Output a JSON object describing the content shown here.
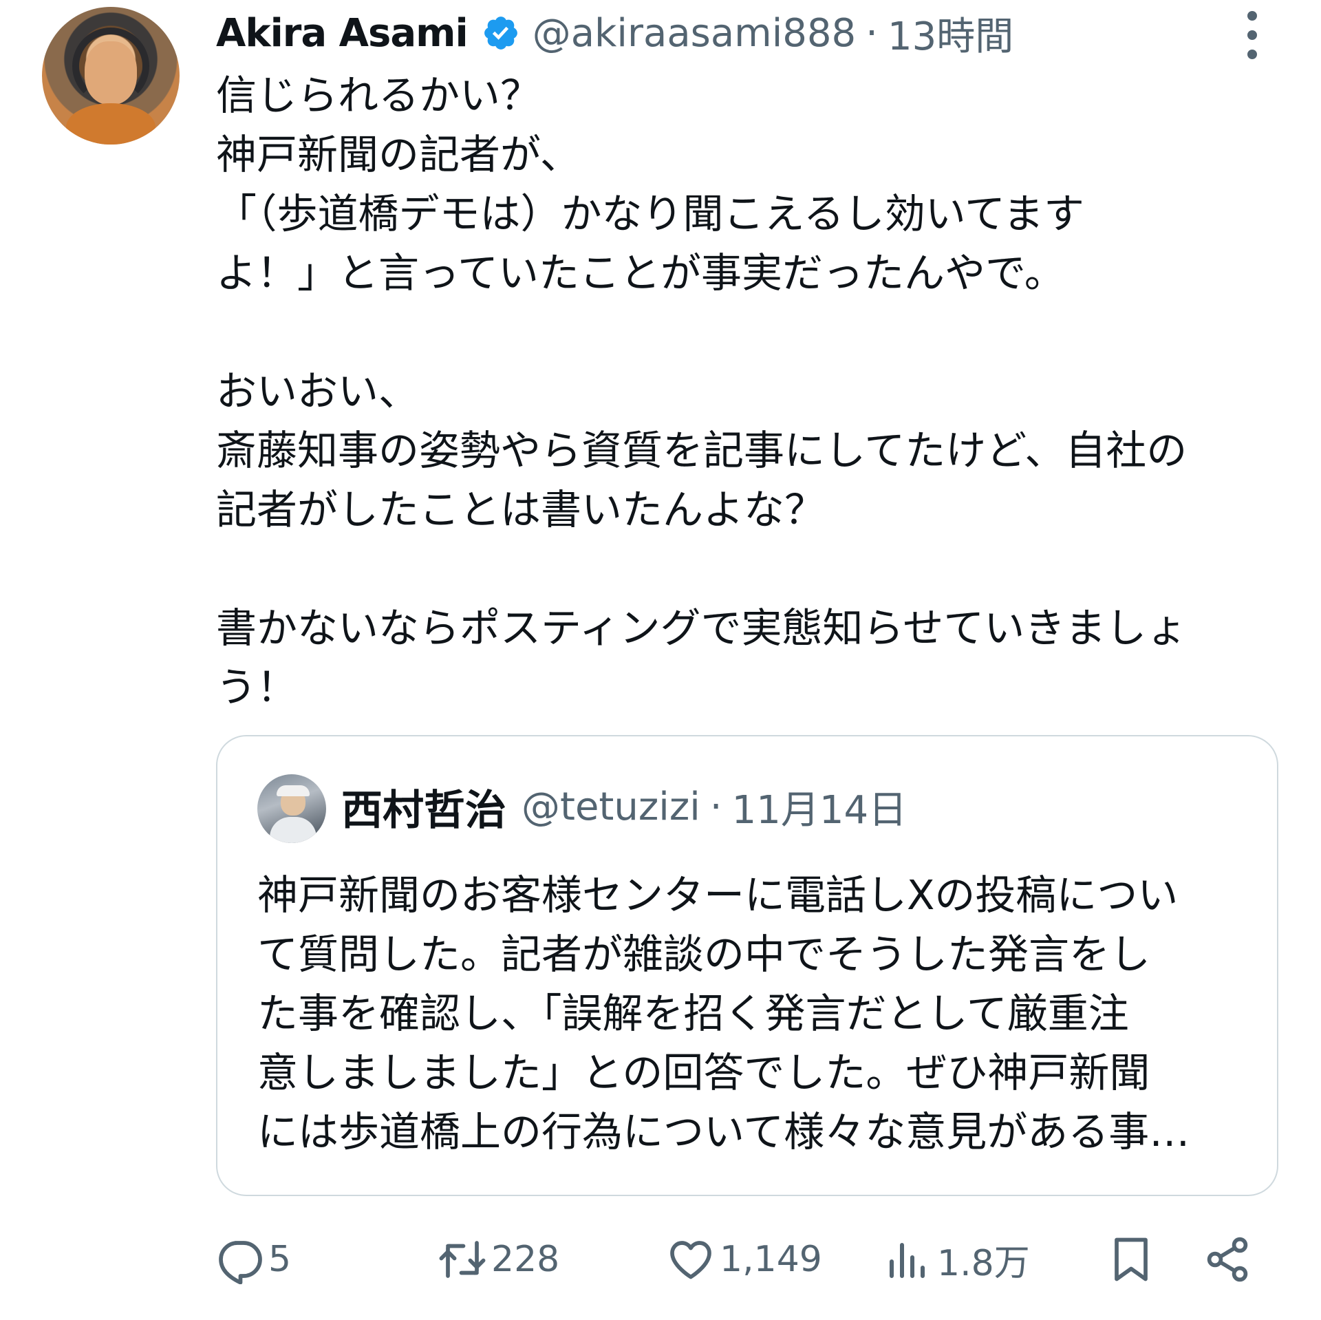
{
  "author": {
    "name": "Akira Asami",
    "handle": "@akiraasami888",
    "separator": "·",
    "time": "13時間",
    "verified_color": "#1d9bf0"
  },
  "post": {
    "text": "信じられるかい？\n神戸新聞の記者が、\n「（歩道橋デモは）かなり聞こえるし効いてます\nよ！」と言っていたことが事実だったんやで。\n\nおいおい、\n斎藤知事の姿勢やら資質を記事にしてたけど、自社の\n記者がしたことは書いたんよな？\n\n書かないならポスティングで実態知らせていきましょ\nう！"
  },
  "quote": {
    "name": "西村哲治",
    "handle": "@tetuzizi",
    "separator": "·",
    "time": "11月14日",
    "text": "神戸新聞のお客様センターに電話しXの投稿につい\nて質問した。記者が雑談の中でそうした発言をし\nた事を確認し、「誤解を招く発言だとして厳重注\n意しましました」との回答でした。ぜひ神戸新聞\nには歩道橋上の行為について様々な意見がある事…"
  },
  "actions": {
    "replies": "5",
    "retweets": "228",
    "likes": "1,149",
    "views": "1.8万"
  },
  "icons": {
    "reply": "reply-icon",
    "retweet": "retweet-icon",
    "like": "heart-icon",
    "views": "views-icon",
    "bookmark": "bookmark-icon",
    "share": "share-icon",
    "more": "more-icon"
  }
}
